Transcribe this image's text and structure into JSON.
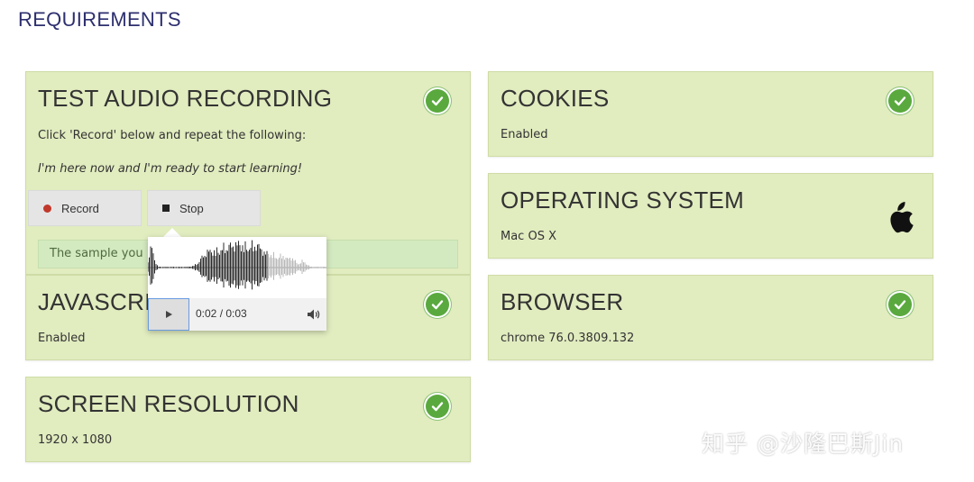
{
  "page": {
    "title": "REQUIREMENTS"
  },
  "audio_test": {
    "title": "TEST AUDIO RECORDING",
    "instruction": "Click 'Record' below and repeat the following:",
    "phrase": "I'm here now and I'm ready to start learning!",
    "record_label": "Record",
    "stop_label": "Stop",
    "sample_text": "The sample you",
    "status_icon": "check-circle-icon",
    "player": {
      "time": "0:02 / 0:03",
      "progress": 0.67
    }
  },
  "javascript": {
    "title": "JAVASCRIPT",
    "value": "Enabled",
    "status_icon": "check-circle-icon"
  },
  "screen_resolution": {
    "title": "SCREEN RESOLUTION",
    "value": "1920 x 1080",
    "status_icon": "check-circle-icon"
  },
  "cookies": {
    "title": "COOKIES",
    "value": "Enabled",
    "status_icon": "check-circle-icon"
  },
  "operating_system": {
    "title": "OPERATING SYSTEM",
    "value": "Mac OS X",
    "status_icon": "apple-logo-icon"
  },
  "browser": {
    "title": "BROWSER",
    "value": "chrome 76.0.3809.132",
    "status_icon": "check-circle-icon"
  },
  "watermark": {
    "text": "知乎 @沙隆巴斯Jin"
  },
  "colors": {
    "card_bg": "#e1ecbf",
    "check_green": "#5aa93e",
    "title_navy": "#2d2f6e",
    "record_red": "#c0392b"
  }
}
